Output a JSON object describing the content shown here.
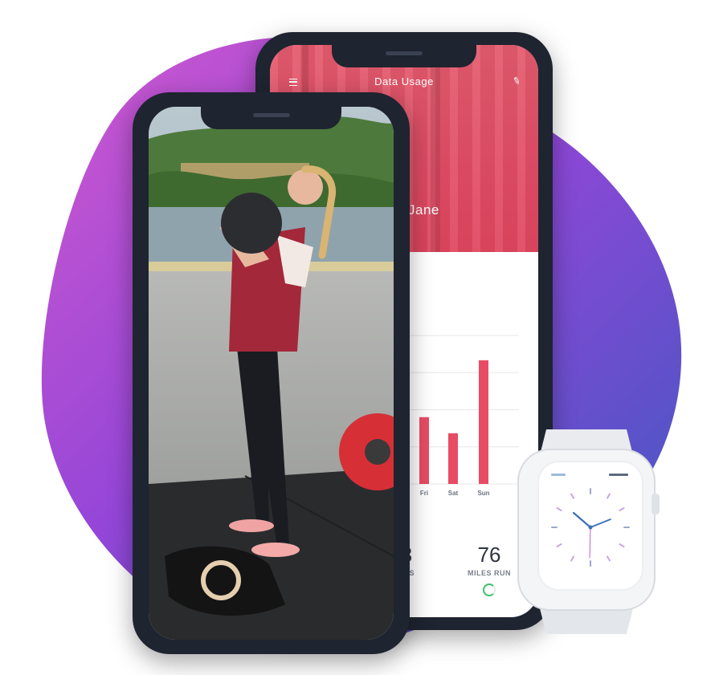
{
  "colors": {
    "blob_top": "#c650d0",
    "blob_mid": "#8b43d8",
    "blob_bottom": "#3e5fb8",
    "accent": "#e84c64",
    "phone_frame": "#1e2430"
  },
  "app": {
    "header_title": "Data Usage",
    "user_name": "Jane",
    "menu_icon": "hamburger-menu-icon",
    "edit_icon": "pencil-icon"
  },
  "chart_data": {
    "type": "bar",
    "categories": [
      "Fri",
      "Sat",
      "Sun"
    ],
    "values": [
      54,
      41,
      100
    ],
    "ylim": [
      0,
      120
    ],
    "grid": true
  },
  "stats": [
    {
      "value": "3",
      "label": "UPS"
    },
    {
      "value": "76",
      "label": "MILES RUN"
    }
  ],
  "watch": {
    "left_text": "",
    "right_text": "",
    "band_color": "#e9ebef"
  }
}
